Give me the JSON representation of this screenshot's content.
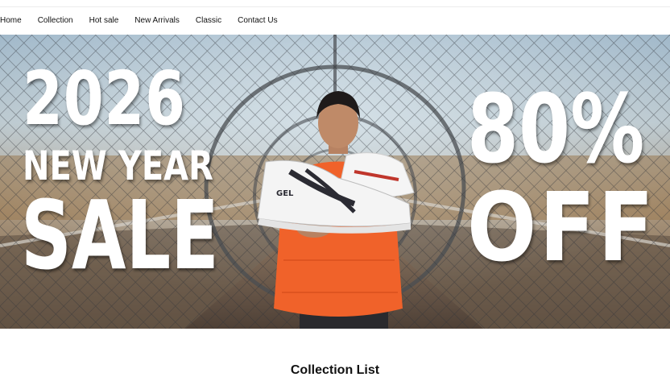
{
  "nav": {
    "items": [
      {
        "label": "Home"
      },
      {
        "label": "Collection"
      },
      {
        "label": "Hot sale"
      },
      {
        "label": "New Arrivals"
      },
      {
        "label": "Classic"
      },
      {
        "label": "Contact Us"
      }
    ]
  },
  "hero": {
    "year": "2026",
    "line2": "NEW YEAR",
    "line3": "SALE",
    "discount": "80%",
    "off": "OFF",
    "shoe_brand": "GEL"
  },
  "collection": {
    "title": "Collection List"
  },
  "colors": {
    "jacket": "#f0622a",
    "shoe_stripe": "#2b2b33",
    "shoe_accent": "#c0362c"
  }
}
